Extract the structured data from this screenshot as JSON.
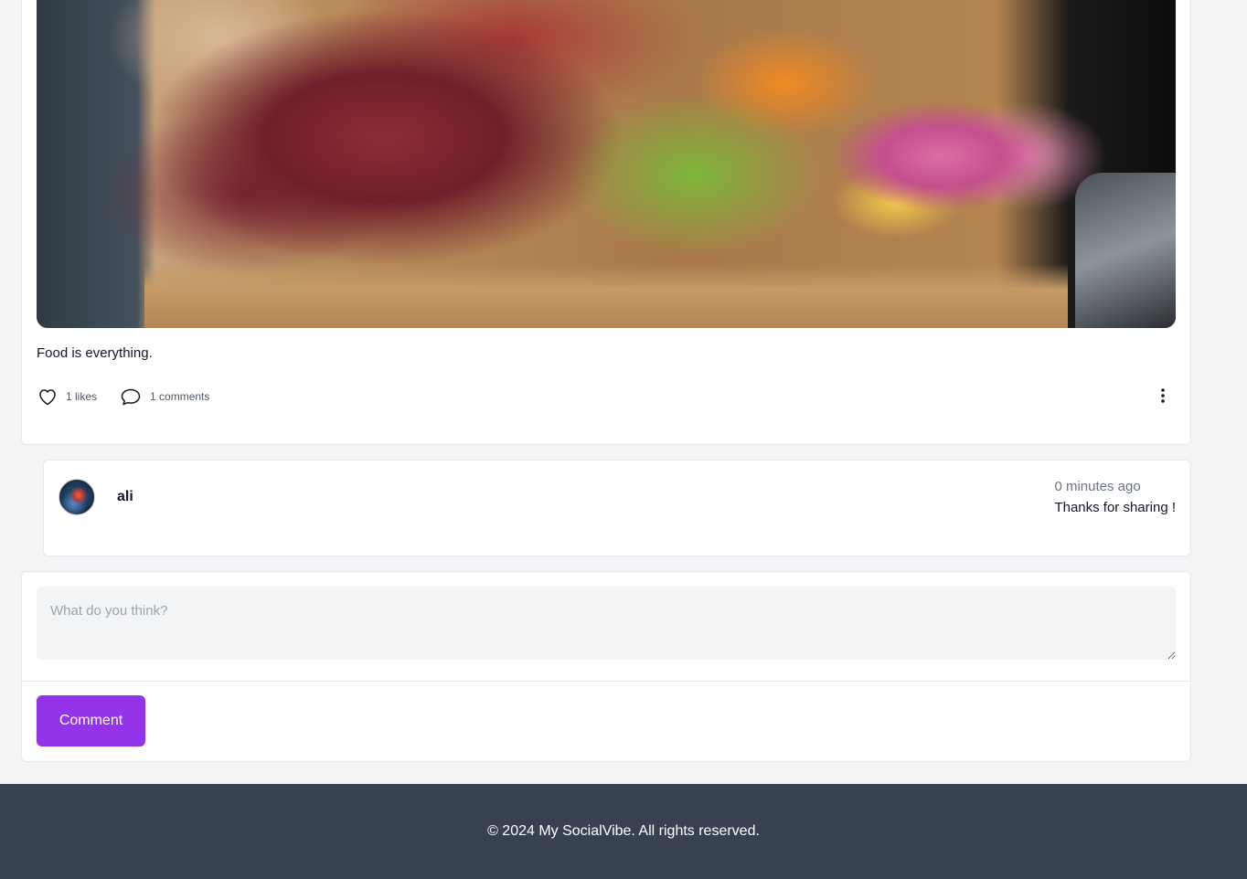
{
  "post": {
    "image_alt": "Charcuterie board with cured meats, pickled eggs and vegetables",
    "caption": "Food is everything.",
    "likes_label": "1 likes",
    "comments_label": "1 comments"
  },
  "comments": [
    {
      "author": "ali",
      "time": "0 minutes ago",
      "text": "Thanks for sharing !"
    }
  ],
  "comment_form": {
    "placeholder": "What do you think?",
    "value": "",
    "submit_label": "Comment"
  },
  "footer": {
    "copyright": "© 2024 My SocialVibe. All rights reserved."
  },
  "colors": {
    "accent": "#9333ea",
    "footer_bg": "#374151",
    "page_bg": "#f3f4f6"
  },
  "icons": {
    "like": "heart-icon",
    "comment": "speech-bubble-icon",
    "more": "vertical-ellipsis-icon"
  }
}
